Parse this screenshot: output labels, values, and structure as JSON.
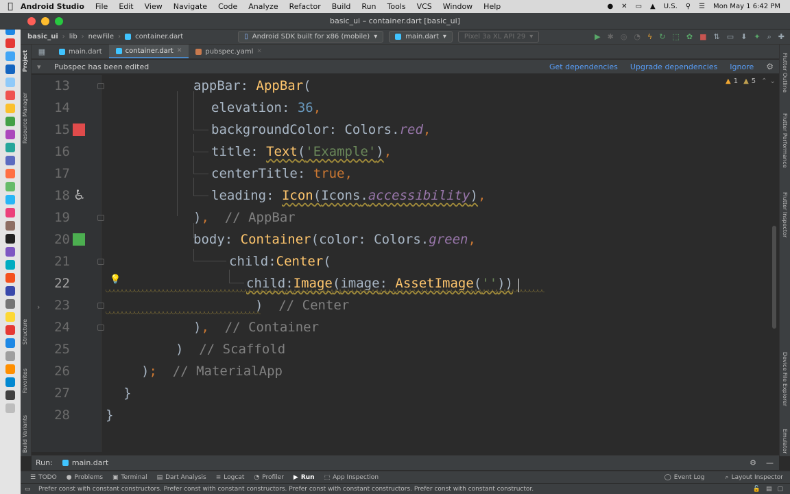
{
  "menubar": {
    "app_name": "Android Studio",
    "items": [
      "File",
      "Edit",
      "View",
      "Navigate",
      "Code",
      "Analyze",
      "Refactor",
      "Build",
      "Run",
      "Tools",
      "VCS",
      "Window",
      "Help"
    ],
    "input_source": "U.S.",
    "clock": "Mon May 1  6:42 PM"
  },
  "window": {
    "title": "basic_ui – container.dart [basic_ui]"
  },
  "navbar": {
    "breadcrumbs": [
      "basic_ui",
      "lib",
      "newFile",
      "container.dart"
    ],
    "device_selector": "Android SDK built for x86 (mobile)",
    "run_config": "main.dart",
    "avd_selector": "Pixel 3a XL API 29"
  },
  "left_tool_tabs": [
    "Project",
    "Resource Manager",
    "Structure",
    "Favorites",
    "Build Variants"
  ],
  "right_tool_tabs": [
    "Flutter Outline",
    "Flutter Performance",
    "Flutter Inspector",
    "Device File Explorer",
    "Emulator"
  ],
  "tabs": [
    {
      "label": "main.dart"
    },
    {
      "label": "container.dart"
    },
    {
      "label": "pubspec.yaml"
    }
  ],
  "banner": {
    "message": "Pubspec has been edited",
    "get_dependencies": "Get dependencies",
    "upgrade_dependencies": "Upgrade dependencies",
    "ignore": "Ignore"
  },
  "inspections": {
    "warnings": "1",
    "weak_warnings": "5"
  },
  "editor": {
    "line_numbers": [
      "13",
      "14",
      "15",
      "16",
      "17",
      "18",
      "19",
      "20",
      "21",
      "22",
      "23",
      "24",
      "25",
      "26",
      "27",
      "28"
    ],
    "current_line": "22",
    "gutter_colors": {
      "line15": "#e04b4b",
      "line20": "#4caf50"
    },
    "tokens": {
      "appBar": "appBar",
      "AppBar": "AppBar",
      "elevation": "elevation",
      "elevation_value": "36",
      "backgroundColor": "backgroundColor",
      "Colors": "Colors",
      "red": "red",
      "title": "title",
      "Text": "Text",
      "example_str": "'Example'",
      "centerTitle": "centerTitle",
      "true_kw": "true",
      "leading": "leading",
      "Icon": "Icon",
      "Icons": "Icons",
      "accessibility": "accessibility",
      "appbar_comment": "// AppBar",
      "body": "body",
      "Container": "Container",
      "color": "color",
      "green": "green",
      "child": "child",
      "Center": "Center",
      "Image": "Image",
      "image": "image",
      "AssetImage": "AssetImage",
      "asset_str": "''",
      "center_comment": "// Center",
      "container_comment": "// Container",
      "scaffold_comment": "// Scaffold",
      "materialapp_comment": "// MaterialApp"
    }
  },
  "runbar": {
    "label": "Run:",
    "config": "main.dart"
  },
  "tool_windows": [
    {
      "label": "TODO",
      "icon": "list-icon"
    },
    {
      "label": "Problems",
      "icon": "problems-icon"
    },
    {
      "label": "Terminal",
      "icon": "terminal-icon"
    },
    {
      "label": "Dart Analysis",
      "icon": "dart-analysis-icon"
    },
    {
      "label": "Logcat",
      "icon": "logcat-icon"
    },
    {
      "label": "Profiler",
      "icon": "profiler-icon"
    },
    {
      "label": "Run",
      "icon": "run-icon"
    },
    {
      "label": "App Inspection",
      "icon": "app-inspection-icon"
    }
  ],
  "tool_windows_right": [
    "Event Log",
    "Layout Inspector"
  ],
  "status": {
    "message": "Prefer const with constant constructors. Prefer const with constant constructors. Prefer const with constant constructors. Prefer const with constant constructor."
  },
  "colors": {
    "accent": "#4a88c7",
    "link": "#589df6",
    "background": "#2b2b2b"
  }
}
